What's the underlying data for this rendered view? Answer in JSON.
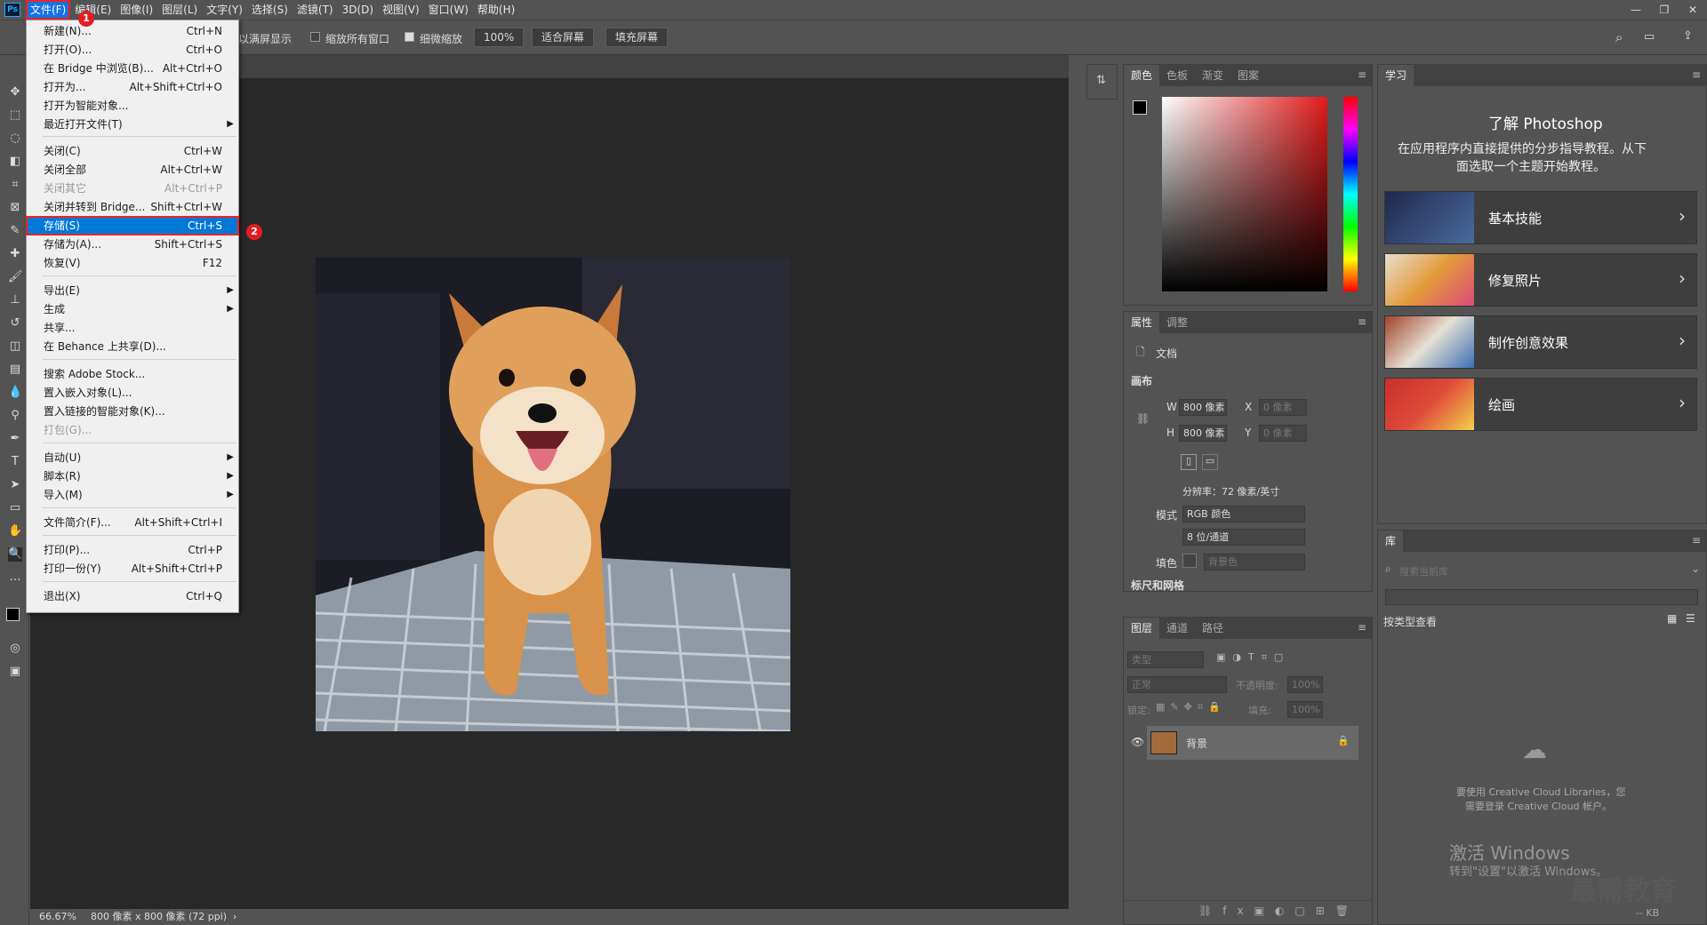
{
  "menubar": {
    "items": [
      "文件(F)",
      "编辑(E)",
      "图像(I)",
      "图层(L)",
      "文字(Y)",
      "选择(S)",
      "滤镜(T)",
      "3D(D)",
      "视图(V)",
      "窗口(W)",
      "帮助(H)"
    ]
  },
  "options": {
    "fullscreen_label": "以满屏显示",
    "zoom_all_label": "缩放所有窗口",
    "scrubby_label": "细微缩放",
    "zoom_value": "100%",
    "fit_screen": "适合屏幕",
    "fill_screen": "填充屏幕"
  },
  "file_menu": [
    {
      "label": "新建(N)...",
      "shortcut": "Ctrl+N"
    },
    {
      "label": "打开(O)...",
      "shortcut": "Ctrl+O"
    },
    {
      "label": "在 Bridge 中浏览(B)...",
      "shortcut": "Alt+Ctrl+O"
    },
    {
      "label": "打开为...",
      "shortcut": "Alt+Shift+Ctrl+O"
    },
    {
      "label": "打开为智能对象...",
      "shortcut": ""
    },
    {
      "label": "最近打开文件(T)",
      "shortcut": ""
    },
    {
      "label": "关闭(C)",
      "shortcut": "Ctrl+W"
    },
    {
      "label": "关闭全部",
      "shortcut": "Alt+Ctrl+W"
    },
    {
      "label": "关闭其它",
      "shortcut": "Alt+Ctrl+P"
    },
    {
      "label": "关闭并转到 Bridge...",
      "shortcut": "Shift+Ctrl+W"
    },
    {
      "label": "存储(S)",
      "shortcut": "Ctrl+S"
    },
    {
      "label": "存储为(A)...",
      "shortcut": "Shift+Ctrl+S"
    },
    {
      "label": "恢复(V)",
      "shortcut": "F12"
    },
    {
      "label": "导出(E)",
      "shortcut": ""
    },
    {
      "label": "生成",
      "shortcut": ""
    },
    {
      "label": "共享...",
      "shortcut": ""
    },
    {
      "label": "在 Behance 上共享(D)...",
      "shortcut": ""
    },
    {
      "label": "搜索 Adobe Stock...",
      "shortcut": ""
    },
    {
      "label": "置入嵌入对象(L)...",
      "shortcut": ""
    },
    {
      "label": "置入链接的智能对象(K)...",
      "shortcut": ""
    },
    {
      "label": "打包(G)...",
      "shortcut": ""
    },
    {
      "label": "自动(U)",
      "shortcut": ""
    },
    {
      "label": "脚本(R)",
      "shortcut": ""
    },
    {
      "label": "导入(M)",
      "shortcut": ""
    },
    {
      "label": "文件简介(F)...",
      "shortcut": "Alt+Shift+Ctrl+I"
    },
    {
      "label": "打印(P)...",
      "shortcut": "Ctrl+P"
    },
    {
      "label": "打印一份(Y)",
      "shortcut": "Alt+Shift+Ctrl+P"
    },
    {
      "label": "退出(X)",
      "shortcut": "Ctrl+Q"
    }
  ],
  "badges": [
    "1",
    "2"
  ],
  "status": {
    "zoom": "66.67%",
    "doc_info": "800 像素 x 800 像素 (72 ppi)"
  },
  "color_panel": {
    "tabs": [
      "颜色",
      "色板",
      "渐变",
      "图案"
    ]
  },
  "properties_panel": {
    "tabs": [
      "属性",
      "调整"
    ],
    "doc_label": "文档",
    "canvas_header": "画布",
    "w_label": "W",
    "w_value": "800 像素",
    "h_label": "H",
    "h_value": "800 像素",
    "x_label": "X",
    "x_value": "0 像素",
    "y_label": "Y",
    "y_value": "0 像素",
    "resolution": "分辨率：72 像素/英寸",
    "mode_label": "模式",
    "mode_value": "RGB 颜色",
    "depth_value": "8 位/通道",
    "fill_label": "填色",
    "fill_value": "背景色",
    "next_section": "标尺和网格"
  },
  "layers_panel": {
    "tabs": [
      "图层",
      "通道",
      "路径"
    ],
    "filter_placeholder": "类型",
    "blend_mode": "正常",
    "opacity_label": "不透明度:",
    "opacity_value": "100%",
    "lock_label": "锁定:",
    "fill_label": "填充:",
    "fill_value": "100%",
    "layer_name": "背景"
  },
  "learn_panel": {
    "tab": "学习",
    "title": "了解 Photoshop",
    "subtitle_1": "在应用程序内直接提供的分步指导教程。从下",
    "subtitle_2": "面选取一个主题开始教程。",
    "cards": [
      "基本技能",
      "修复照片",
      "制作创意效果",
      "绘画"
    ]
  },
  "library_panel": {
    "tab": "库",
    "search_placeholder": "搜索当前库",
    "view_by": "按类型查看",
    "msg_1": "要使用 Creative Cloud Libraries，您",
    "msg_2": "需要登录 Creative Cloud 帐户。",
    "kb": "-- KB"
  },
  "watermark": {
    "line1": "激活 Windows",
    "line2": "转到\"设置\"以激活 Windows。",
    "brand": "最需教育"
  }
}
